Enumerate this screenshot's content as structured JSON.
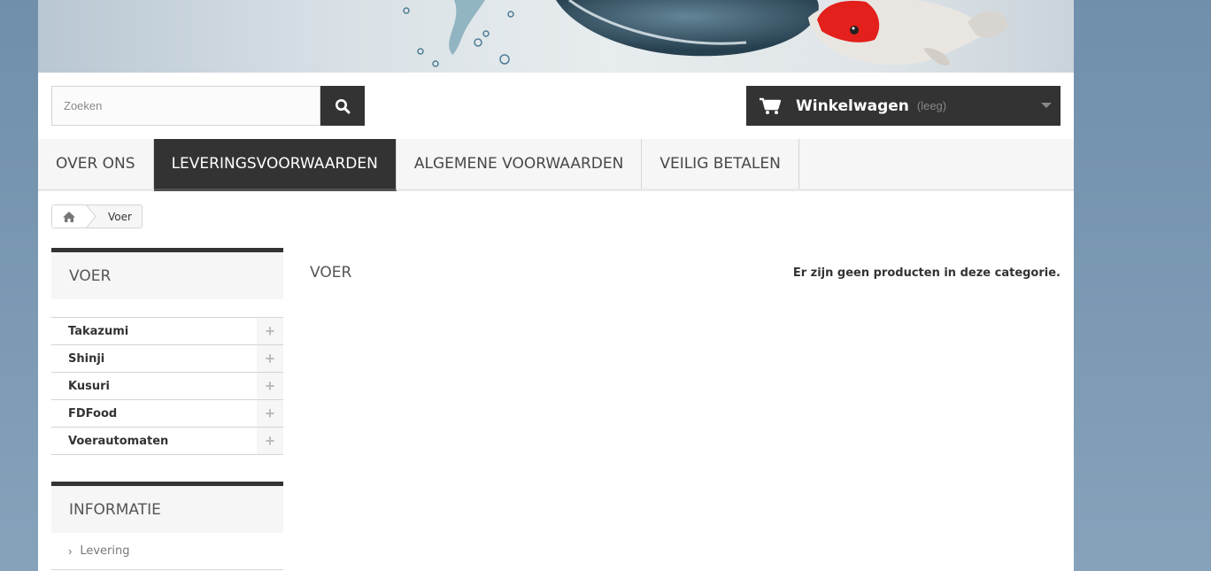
{
  "search": {
    "placeholder": "Zoeken",
    "button_icon": "search-icon"
  },
  "cart": {
    "title": "Winkelwagen",
    "status": "(leeg)",
    "icon": "shopping-cart-icon"
  },
  "menu": {
    "items": [
      {
        "label": "OVER ONS",
        "active": false
      },
      {
        "label": "LEVERINGSVOORWAARDEN",
        "active": true
      },
      {
        "label": "ALGEMENE VOORWAARDEN",
        "active": false
      },
      {
        "label": "VEILIG BETALEN",
        "active": false
      }
    ]
  },
  "breadcrumb": {
    "home_icon": "home-icon",
    "current": "Voer"
  },
  "sidebar": {
    "categories_title": "VOER",
    "categories": [
      {
        "label": "Takazumi"
      },
      {
        "label": "Shinji"
      },
      {
        "label": "Kusuri"
      },
      {
        "label": "FDFood"
      },
      {
        "label": "Voerautomaten"
      }
    ],
    "info_title": "INFORMATIE",
    "info_items": [
      {
        "label": "Levering"
      }
    ]
  },
  "main": {
    "title": "VOER",
    "message": "Er zijn geen producten in deze categorie."
  }
}
